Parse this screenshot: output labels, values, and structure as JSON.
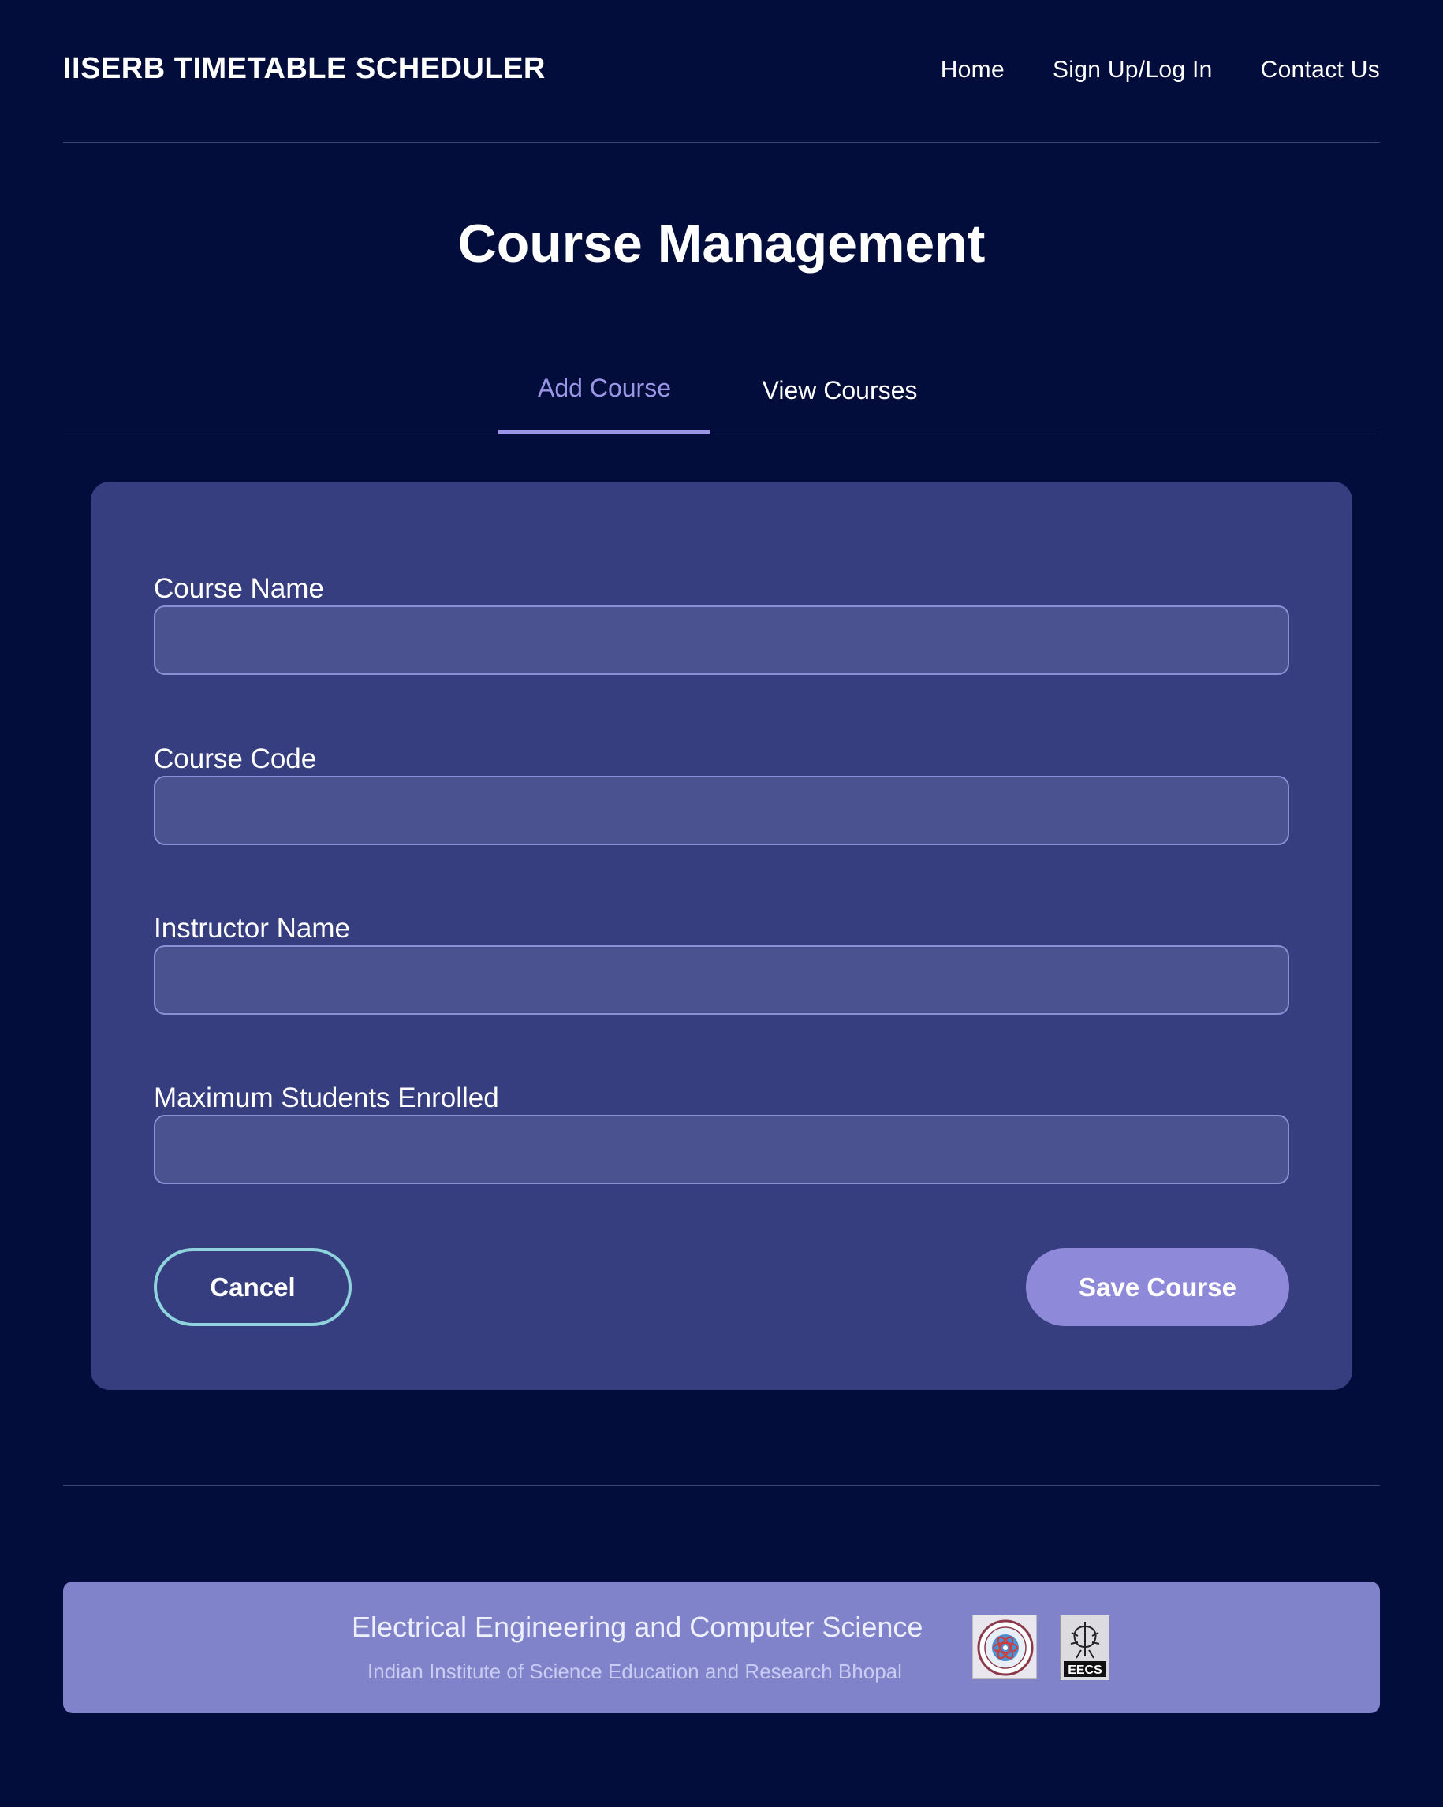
{
  "header": {
    "brand": "IISERB TIMETABLE SCHEDULER",
    "nav": [
      "Home",
      "Sign Up/Log In",
      "Contact Us"
    ]
  },
  "page": {
    "title": "Course Management"
  },
  "tabs": {
    "active": "Add Course",
    "items": [
      "Add Course",
      "View Courses"
    ]
  },
  "form": {
    "fields": [
      {
        "label": "Course Name",
        "value": "",
        "placeholder": ""
      },
      {
        "label": "Course Code",
        "value": "",
        "placeholder": ""
      },
      {
        "label": "Instructor Name",
        "value": "",
        "placeholder": ""
      },
      {
        "label": "Maximum Students Enrolled",
        "value": "",
        "placeholder": ""
      }
    ],
    "cancel_label": "Cancel",
    "save_label": "Save Course"
  },
  "footer": {
    "title": "Electrical Engineering and Computer Science",
    "subtitle": "Indian Institute of Science Education and Research Bhopal",
    "logos": [
      "iiser-bhopal-logo",
      "eecs-logo"
    ],
    "eecs_logo_text": "EECS"
  },
  "colors": {
    "background": "#020d3b",
    "card": "#363e80",
    "input": "#4a528f",
    "accent": "#9b95e6",
    "save_button": "#8e8ad9",
    "cancel_border": "#8fd3dc",
    "footer": "#8082ca"
  }
}
